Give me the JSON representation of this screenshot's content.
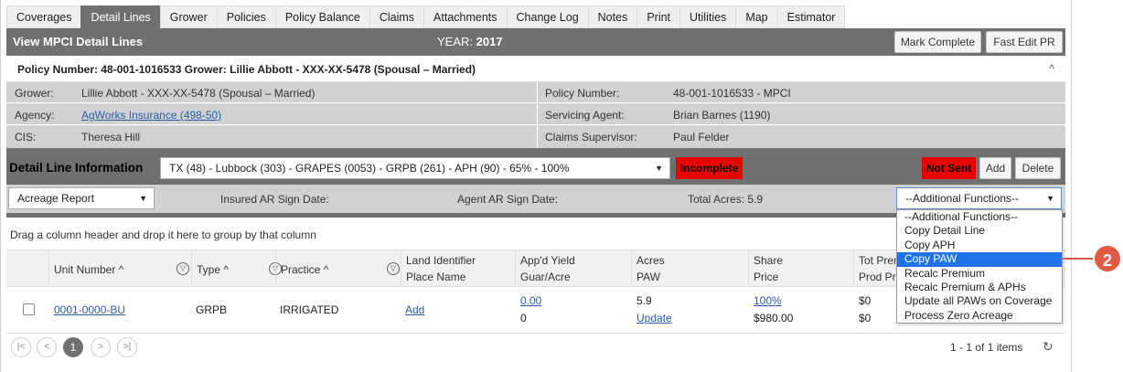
{
  "tabs": [
    "Coverages",
    "Detail Lines",
    "Grower",
    "Policies",
    "Policy Balance",
    "Claims",
    "Attachments",
    "Change Log",
    "Notes",
    "Print",
    "Utilities",
    "Map",
    "Estimator"
  ],
  "active_tab": "Detail Lines",
  "header": {
    "title": "View MPCI Detail Lines",
    "year_label": "YEAR:",
    "year_value": "2017",
    "mark_complete": "Mark Complete",
    "fast_edit": "Fast Edit PR"
  },
  "policy_bar": {
    "text": "Policy Number: 48-001-1016533 Grower: Lillie Abbott - XXX-XX-5478 (Spousal – Married)",
    "collapse_glyph": "^"
  },
  "info": {
    "grower_label": "Grower:",
    "grower_value": "Lillie Abbott - XXX-XX-5478 (Spousal – Married)",
    "agency_label": "Agency:",
    "agency_value": "AgWorks Insurance (498-50)",
    "cis_label": "CIS:",
    "cis_value": "Theresa Hill",
    "policy_number_label": "Policy Number:",
    "policy_number_value": "48-001-1016533 - MPCI",
    "servicing_agent_label": "Servicing Agent:",
    "servicing_agent_value": "Brian Barnes (1190)",
    "claims_supervisor_label": "Claims Supervisor:",
    "claims_supervisor_value": "Paul Felder"
  },
  "detail_line": {
    "title": "Detail Line Information",
    "selected_line": "TX (48) - Lubbock (303) - GRAPES (0053) - GRPB (261) - APH (90) - 65% - 100%",
    "status_badge": "Incomplete",
    "sent_badge": "Not Sent",
    "add": "Add",
    "delete": "Delete",
    "report_select": "Acreage Report",
    "insured_ar_sign_date": "Insured AR Sign Date:",
    "agent_ar_sign_date": "Agent AR Sign Date:",
    "total_acres": "Total Acres: 5.9",
    "additional_functions": "--Additional Functions--"
  },
  "grid": {
    "group_hint": "Drag a column header and drop it here to group by that column",
    "columns": {
      "unit_number": "Unit Number",
      "type": "Type",
      "practice": "Practice",
      "land_identifier": "Land Identifier",
      "place_name": "Place Name",
      "appd_yield": "App'd Yield",
      "guar_acre": "Guar/Acre",
      "acres": "Acres",
      "paw": "PAW",
      "share": "Share",
      "price": "Price",
      "tot_prem": "Tot Prem",
      "prod_prem": "Prod Pr"
    },
    "sort_glyph": "^",
    "row": {
      "unit_number": "0001-0000-BU",
      "type": "GRPB",
      "practice": "IRRIGATED",
      "land_add": "Add",
      "appd_yield": "0.00",
      "guar_acre": "0",
      "acres": "5.9",
      "paw_update": "Update",
      "share": "100%",
      "price": "$980.00",
      "tot_prem": "$0",
      "prod_prem": "$0"
    }
  },
  "pager": {
    "first": "|<",
    "prev": "<",
    "current": "1",
    "next": ">",
    "last": ">|",
    "info": "1 - 1 of 1 items",
    "refresh_glyph": "↻"
  },
  "dropdown_menu": {
    "items": [
      "--Additional Functions--",
      "Copy Detail Line",
      "Copy APH",
      "Copy PAW",
      "Recalc Premium",
      "Recalc Premium & APHs",
      "Update all PAWs on Coverage",
      "Process Zero Acreage"
    ],
    "highlighted": "Copy PAW"
  },
  "callout": {
    "number": "2"
  },
  "colors": {
    "header_gray": "#707070",
    "info_gray": "#d1d1d1",
    "badge_red": "#ee0000",
    "highlight_blue": "#1e73e8",
    "callout_red": "#e05a44",
    "link_blue": "#2a5ea8"
  }
}
